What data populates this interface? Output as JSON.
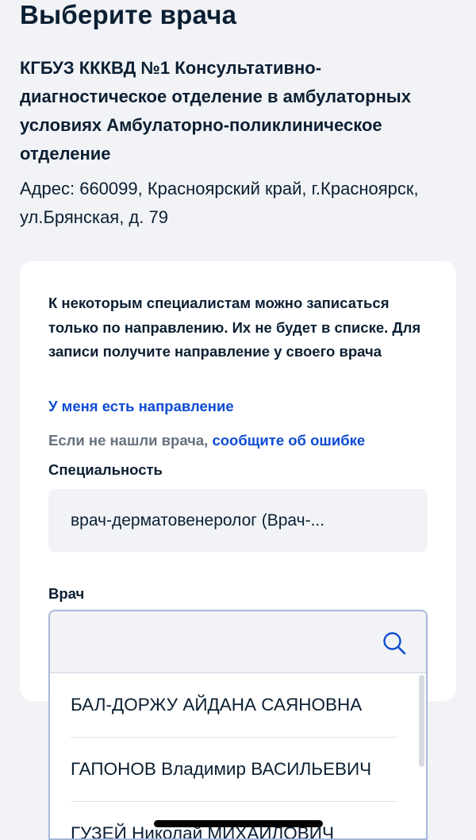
{
  "header": {
    "title": "Выберите врача"
  },
  "organization": {
    "name": "КГБУЗ КККВД №1 Консультативно-диагностическое отделение в амбулаторных условиях Амбулаторно-поликлиническое отделение",
    "address": "Адрес: 660099, Красноярский край, г.Красноярск, ул.Брянская, д. 79"
  },
  "form": {
    "info_text": "К некоторым специалистам можно записаться только по направлению. Их не будет в списке. Для записи получите направление у своего врача",
    "referral_link": "У меня есть направление",
    "error_prefix": "Если не нашли врача, ",
    "error_link": "сообщите об ошибке",
    "specialty_label": "Специальность",
    "specialty_value": "врач-дерматовенеролог (Врач-...",
    "doctor_label": "Врач",
    "doctor_search_value": ""
  },
  "dropdown": {
    "options": [
      "БАЛ-ДОРЖУ АЙДАНА САЯНОВНА",
      "ГАПОНОВ Владимир ВАСИЛЬЕВИЧ",
      "ГУЗЕЙ Николай МИХАЙЛОВИЧ"
    ]
  },
  "icons": {
    "search": "search-icon"
  },
  "colors": {
    "accent": "#0d4cd3",
    "text": "#0b1f33",
    "muted": "#66727f",
    "background": "#f2f3f6",
    "field": "#f1f3f6",
    "focus_border": "#a5b7dc"
  }
}
